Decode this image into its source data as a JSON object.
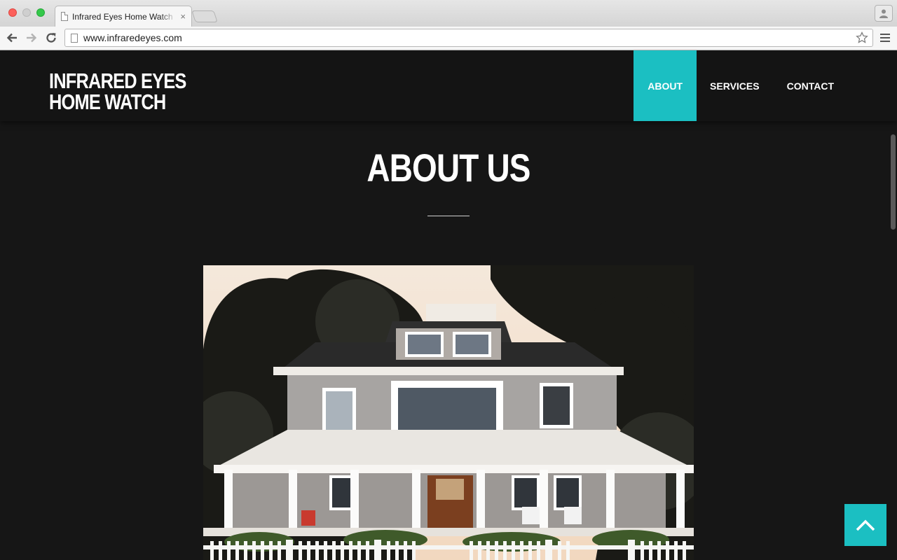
{
  "browser": {
    "tab_title": "Infrared Eyes Home Watch",
    "tab_close": "×",
    "url": "www.infraredeyes.com"
  },
  "site": {
    "logo_line1": "INFRARED EYES",
    "logo_line2": "HOME WATCH",
    "nav": [
      {
        "label": "ABOUT",
        "active": true
      },
      {
        "label": "SERVICES",
        "active": false
      },
      {
        "label": "CONTACT",
        "active": false
      }
    ],
    "section_title": "ABOUT US",
    "accent_color": "#1bbfc2"
  }
}
